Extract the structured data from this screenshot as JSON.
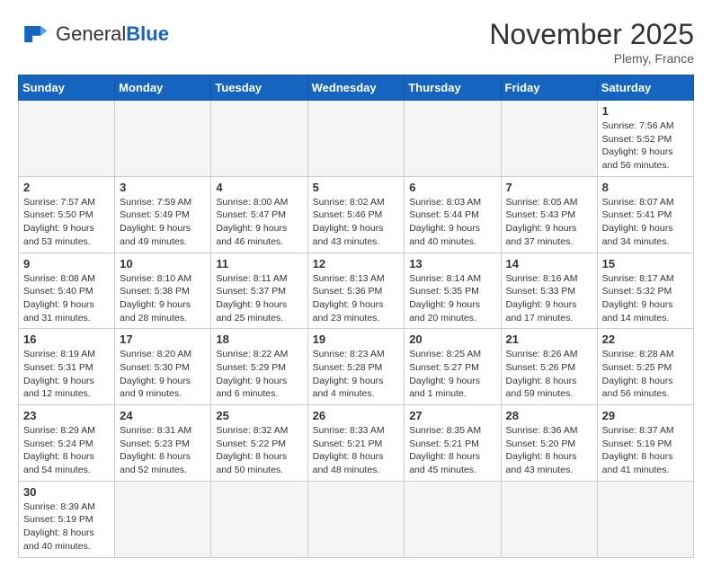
{
  "header": {
    "logo_general": "General",
    "logo_blue": "Blue",
    "month_title": "November 2025",
    "location": "Plemy, France"
  },
  "weekdays": [
    "Sunday",
    "Monday",
    "Tuesday",
    "Wednesday",
    "Thursday",
    "Friday",
    "Saturday"
  ],
  "days": {
    "1": {
      "sunrise": "7:56 AM",
      "sunset": "5:52 PM",
      "daylight": "9 hours and 56 minutes."
    },
    "2": {
      "sunrise": "7:57 AM",
      "sunset": "5:50 PM",
      "daylight": "9 hours and 53 minutes."
    },
    "3": {
      "sunrise": "7:59 AM",
      "sunset": "5:49 PM",
      "daylight": "9 hours and 49 minutes."
    },
    "4": {
      "sunrise": "8:00 AM",
      "sunset": "5:47 PM",
      "daylight": "9 hours and 46 minutes."
    },
    "5": {
      "sunrise": "8:02 AM",
      "sunset": "5:46 PM",
      "daylight": "9 hours and 43 minutes."
    },
    "6": {
      "sunrise": "8:03 AM",
      "sunset": "5:44 PM",
      "daylight": "9 hours and 40 minutes."
    },
    "7": {
      "sunrise": "8:05 AM",
      "sunset": "5:43 PM",
      "daylight": "9 hours and 37 minutes."
    },
    "8": {
      "sunrise": "8:07 AM",
      "sunset": "5:41 PM",
      "daylight": "9 hours and 34 minutes."
    },
    "9": {
      "sunrise": "8:08 AM",
      "sunset": "5:40 PM",
      "daylight": "9 hours and 31 minutes."
    },
    "10": {
      "sunrise": "8:10 AM",
      "sunset": "5:38 PM",
      "daylight": "9 hours and 28 minutes."
    },
    "11": {
      "sunrise": "8:11 AM",
      "sunset": "5:37 PM",
      "daylight": "9 hours and 25 minutes."
    },
    "12": {
      "sunrise": "8:13 AM",
      "sunset": "5:36 PM",
      "daylight": "9 hours and 23 minutes."
    },
    "13": {
      "sunrise": "8:14 AM",
      "sunset": "5:35 PM",
      "daylight": "9 hours and 20 minutes."
    },
    "14": {
      "sunrise": "8:16 AM",
      "sunset": "5:33 PM",
      "daylight": "9 hours and 17 minutes."
    },
    "15": {
      "sunrise": "8:17 AM",
      "sunset": "5:32 PM",
      "daylight": "9 hours and 14 minutes."
    },
    "16": {
      "sunrise": "8:19 AM",
      "sunset": "5:31 PM",
      "daylight": "9 hours and 12 minutes."
    },
    "17": {
      "sunrise": "8:20 AM",
      "sunset": "5:30 PM",
      "daylight": "9 hours and 9 minutes."
    },
    "18": {
      "sunrise": "8:22 AM",
      "sunset": "5:29 PM",
      "daylight": "9 hours and 6 minutes."
    },
    "19": {
      "sunrise": "8:23 AM",
      "sunset": "5:28 PM",
      "daylight": "9 hours and 4 minutes."
    },
    "20": {
      "sunrise": "8:25 AM",
      "sunset": "5:27 PM",
      "daylight": "9 hours and 1 minute."
    },
    "21": {
      "sunrise": "8:26 AM",
      "sunset": "5:26 PM",
      "daylight": "8 hours and 59 minutes."
    },
    "22": {
      "sunrise": "8:28 AM",
      "sunset": "5:25 PM",
      "daylight": "8 hours and 56 minutes."
    },
    "23": {
      "sunrise": "8:29 AM",
      "sunset": "5:24 PM",
      "daylight": "8 hours and 54 minutes."
    },
    "24": {
      "sunrise": "8:31 AM",
      "sunset": "5:23 PM",
      "daylight": "8 hours and 52 minutes."
    },
    "25": {
      "sunrise": "8:32 AM",
      "sunset": "5:22 PM",
      "daylight": "8 hours and 50 minutes."
    },
    "26": {
      "sunrise": "8:33 AM",
      "sunset": "5:21 PM",
      "daylight": "8 hours and 48 minutes."
    },
    "27": {
      "sunrise": "8:35 AM",
      "sunset": "5:21 PM",
      "daylight": "8 hours and 45 minutes."
    },
    "28": {
      "sunrise": "8:36 AM",
      "sunset": "5:20 PM",
      "daylight": "8 hours and 43 minutes."
    },
    "29": {
      "sunrise": "8:37 AM",
      "sunset": "5:19 PM",
      "daylight": "8 hours and 41 minutes."
    },
    "30": {
      "sunrise": "8:39 AM",
      "sunset": "5:19 PM",
      "daylight": "8 hours and 40 minutes."
    }
  }
}
